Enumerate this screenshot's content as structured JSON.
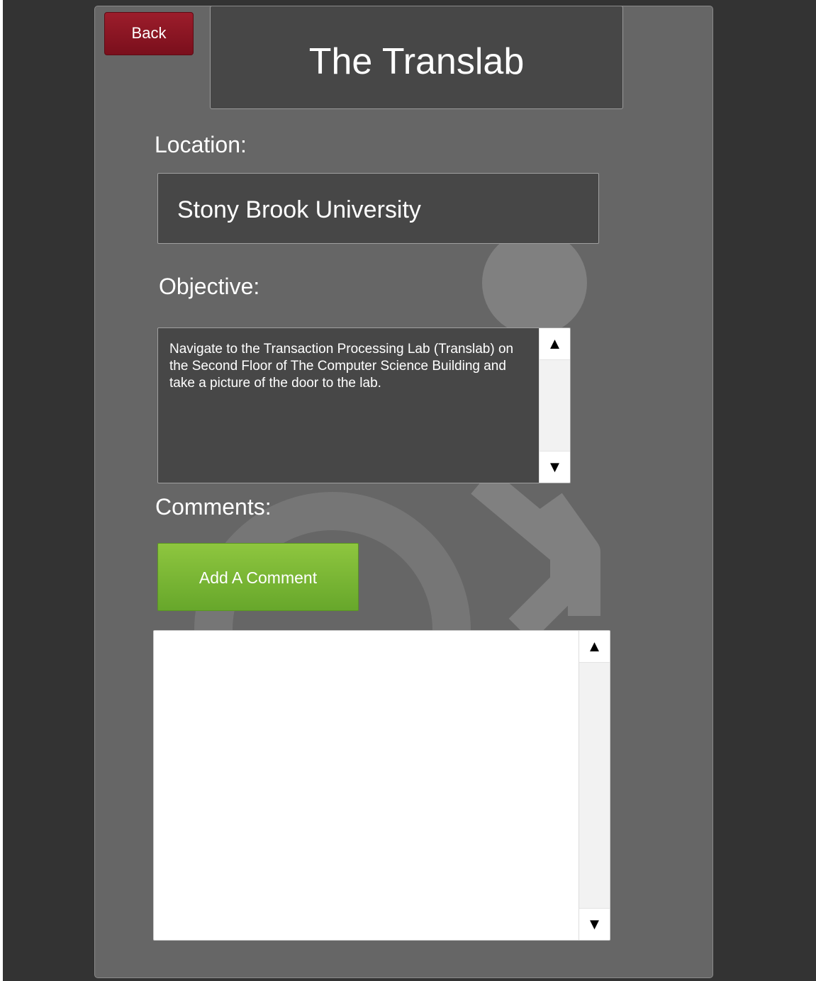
{
  "header": {
    "back_label": "Back",
    "title": "The Translab"
  },
  "location": {
    "label": "Location:",
    "value": "Stony Brook University"
  },
  "objective": {
    "label": "Objective:",
    "text": "Navigate to the Transaction Processing Lab (Translab) on the Second Floor of The Computer Science Building and take a picture of the door to the lab."
  },
  "comments": {
    "label": "Comments:",
    "add_label": "Add A Comment"
  },
  "scroll": {
    "up_glyph": "▲",
    "down_glyph": "▼"
  },
  "colors": {
    "panel": "#666666",
    "back_button": "#8b1524",
    "add_button": "#7ab834",
    "field_bg": "#474747"
  },
  "icons": {
    "background": "accessibility-wheelchair-icon"
  }
}
